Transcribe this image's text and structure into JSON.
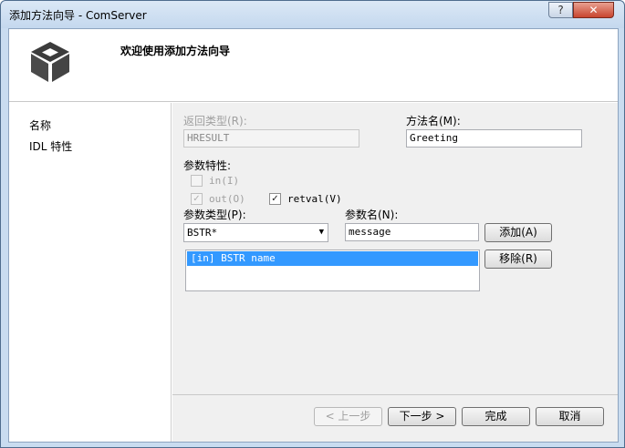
{
  "window": {
    "title": "添加方法向导 - ComServer",
    "help_label": "?",
    "close_label": "✕"
  },
  "header": {
    "welcome": "欢迎使用添加方法向导",
    "logo_icon": "cube-icon"
  },
  "sidebar": {
    "items": [
      {
        "label": "名称"
      },
      {
        "label": "IDL 特性"
      }
    ]
  },
  "form": {
    "return_type_label": "返回类型(R):",
    "return_type_value": "HRESULT",
    "method_name_label": "方法名(M):",
    "method_name_value": "Greeting",
    "param_attr_label": "参数特性:",
    "in_label": "in(I)",
    "out_label": "out(O)",
    "retval_label": "retval(V)",
    "param_type_label": "参数类型(P):",
    "param_type_value": "BSTR*",
    "param_name_label": "参数名(N):",
    "param_name_value": "message",
    "add_button": "添加(A)",
    "remove_button": "移除(R)",
    "param_list": [
      {
        "text": "[in] BSTR name"
      }
    ]
  },
  "footer": {
    "prev_button": "< 上一步",
    "next_button": "下一步 >",
    "finish_button": "完成",
    "cancel_button": "取消"
  }
}
